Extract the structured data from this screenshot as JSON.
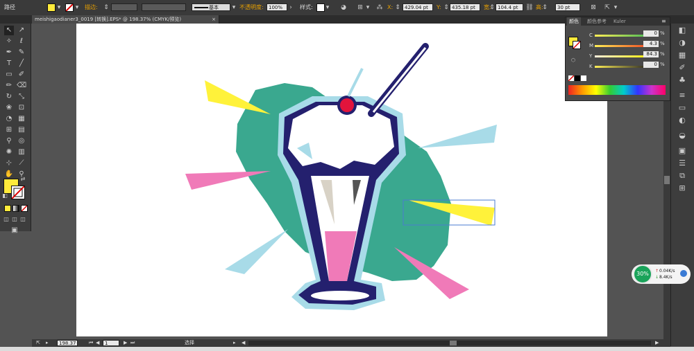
{
  "control_bar": {
    "mode_label": "路径",
    "stroke_label": "描边:",
    "stroke_style": "基本",
    "opacity_label": "不透明度:",
    "opacity_value": "100%",
    "style_label": "样式:",
    "x_label": "X:",
    "x_value": "429.04 pt",
    "y_label": "Y:",
    "y_value": "435.18 pt",
    "w_label": "宽:",
    "w_value": "104.4 pt",
    "h_label": "高:",
    "h_value": "30 pt"
  },
  "document": {
    "tab_title": "meishigaodianer3_0019 [转换].EPS* @ 198.37% (CMYK/预览)"
  },
  "color_panel": {
    "tabs": [
      "颜色",
      "颜色参考",
      "Kuler"
    ],
    "channels": [
      {
        "name": "C",
        "value": "0"
      },
      {
        "name": "M",
        "value": "4.3"
      },
      {
        "name": "Y",
        "value": "84.3"
      },
      {
        "name": "K",
        "value": "0"
      }
    ],
    "unit": "%"
  },
  "status_bar": {
    "zoom": "198.37",
    "artboard": "1",
    "tool_label": "选择"
  },
  "net_widget": {
    "cpu": "30%",
    "upload": "0.04K/s",
    "download": "8.4K/s"
  },
  "colors": {
    "fill": "#ffeb3b",
    "teal": "#3aa88f",
    "navy": "#24206e",
    "light_blue": "#a8dbe8",
    "pink": "#f07ab8",
    "yellow": "#fff23a"
  }
}
